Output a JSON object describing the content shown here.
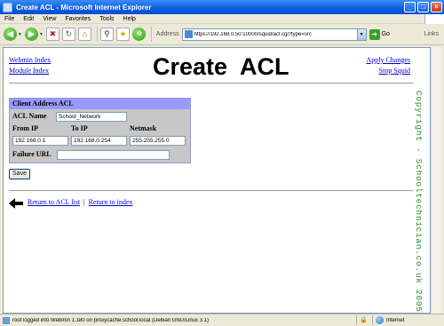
{
  "window": {
    "title": "Create ACL - Microsoft Internet Explorer",
    "min": "_",
    "max": "□",
    "close": "×"
  },
  "menu": [
    "File",
    "Edit",
    "View",
    "Favorites",
    "Tools",
    "Help"
  ],
  "toolbar": {
    "address_label": "Address",
    "url": "https://192.168.0.50:10000/squid/acl.cgi?type=src",
    "go_label": "Go",
    "links_label": "Links"
  },
  "page": {
    "title": "Create  ACL",
    "left_links": [
      "Webmin Index",
      "Module Index"
    ],
    "right_links": [
      "Apply Changes",
      "Stop Squid"
    ]
  },
  "form": {
    "header": "Client Address ACL",
    "acl_name_label": "ACL Name",
    "acl_name_value": "School_Network",
    "from_ip_label": "From IP",
    "to_ip_label": "To IP",
    "netmask_label": "Netmask",
    "from_ip_value": "192.168.0.1",
    "to_ip_value": "192.168.0.254",
    "netmask_value": "255.255.255.0",
    "failure_url_label": "Failure URL",
    "failure_url_value": "",
    "save_label": "Save"
  },
  "footer_links": {
    "acl_list": "Return to ACL list",
    "separator": "|",
    "index": "Return to index"
  },
  "watermark": "Copyright - Schooltechnician.co.uk 2005",
  "status": {
    "text": "root logged into Webmin 1.180 on proxycache.school.local (Debian GNU/Linux 3.1)",
    "zone": "Internet"
  },
  "colors": {
    "titlebar": "#0a5ce0",
    "form_header": "#9999ff",
    "watermark": "#2a8a2a"
  }
}
